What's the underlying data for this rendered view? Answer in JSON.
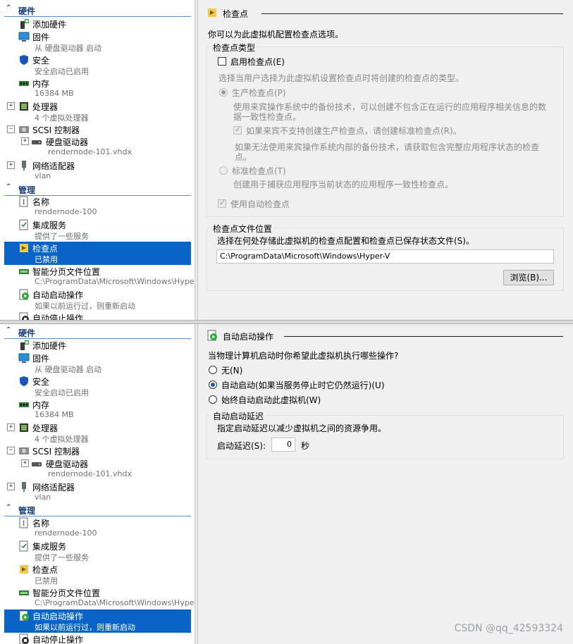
{
  "colors": {
    "selection": "#0a64c8",
    "section_header": "#1a3e7a",
    "pane_bg": "#f0f0f0"
  },
  "top_panel": {
    "tree": {
      "hardware_header": "硬件",
      "items": [
        {
          "icon": "add-hardware-icon",
          "label": "添加硬件",
          "sub": ""
        },
        {
          "icon": "firmware-icon",
          "label": "固件",
          "sub": "从 硬盘驱动器 启动"
        },
        {
          "icon": "security-shield-icon",
          "label": "安全",
          "sub": "安全启动已启用"
        },
        {
          "icon": "memory-icon",
          "label": "内存",
          "sub": "16384 MB"
        },
        {
          "icon": "processor-icon",
          "label": "处理器",
          "sub": "4 个虚拟处理器"
        },
        {
          "icon": "scsi-icon",
          "label": "SCSI 控制器",
          "sub": ""
        },
        {
          "icon": "hard-drive-icon",
          "label": "硬盘驱动器",
          "sub": "rendernode-101.vhdx"
        },
        {
          "icon": "network-adapter-icon",
          "label": "网络适配器",
          "sub": "vlan"
        }
      ],
      "management_header": "管理",
      "mgmt_items": [
        {
          "icon": "name-icon",
          "label": "名称",
          "sub": "rendernode-100"
        },
        {
          "icon": "integration-services-icon",
          "label": "集成服务",
          "sub": "提供了一些服务"
        },
        {
          "icon": "checkpoint-icon",
          "label": "检查点",
          "sub": "已禁用"
        },
        {
          "icon": "smart-paging-icon",
          "label": "智能分页文件位置",
          "sub": "C:\\ProgramData\\Microsoft\\Windows\\Hyper-V"
        },
        {
          "icon": "auto-start-icon",
          "label": "自动启动操作",
          "sub": "如果以前运行过，则重新启动"
        },
        {
          "icon": "auto-stop-icon",
          "label": "自动停止操作",
          "sub": ""
        }
      ]
    },
    "detail": {
      "title": "检查点",
      "intro": "你可以为此虚拟机配置检查点选项。",
      "type_group_title": "检查点类型",
      "enable_checkpoints": "启用检查点(E)",
      "choose_hint": "选择当用户选择为此虚拟机设置检查点时将创建的检查点的类型。",
      "production_label": "生产检查点(P)",
      "production_desc1": "使用来宾操作系统中的备份技术，可以创建不包含正在运行的应用程序相关信息的数",
      "production_desc2": "据一致性检查点。",
      "fallback_label": "如果来宾不支持创建生产检查点，请创建标准检查点(R)。",
      "fallback_desc1": "如果无法使用来宾操作系统内部的备份技术，请获取包含完整应用程序状态的检查",
      "fallback_desc2": "点。",
      "standard_label": "标准检查点(T)",
      "standard_desc": "创建用于捕获应用程序当前状态的应用程序一致性检查点。",
      "auto_label": "使用自动检查点",
      "location_group_title": "检查点文件位置",
      "location_desc": "选择在何处存储此虚拟机的检查点配置和检查点已保存状态文件(S)。",
      "location_value": "C:\\ProgramData\\Microsoft\\Windows\\Hyper-V",
      "browse_label": "浏览(B)..."
    }
  },
  "bottom_panel": {
    "tree": {
      "hardware_header": "硬件",
      "items": [
        {
          "icon": "add-hardware-icon",
          "label": "添加硬件",
          "sub": ""
        },
        {
          "icon": "firmware-icon",
          "label": "固件",
          "sub": "从 硬盘驱动器 启动"
        },
        {
          "icon": "security-shield-icon",
          "label": "安全",
          "sub": "安全启动已启用"
        },
        {
          "icon": "memory-icon",
          "label": "内存",
          "sub": "16384 MB"
        },
        {
          "icon": "processor-icon",
          "label": "处理器",
          "sub": "4 个虚拟处理器"
        },
        {
          "icon": "scsi-icon",
          "label": "SCSI 控制器",
          "sub": ""
        },
        {
          "icon": "hard-drive-icon",
          "label": "硬盘驱动器",
          "sub": "rendernode-101.vhdx"
        },
        {
          "icon": "network-adapter-icon",
          "label": "网络适配器",
          "sub": "vlan"
        }
      ],
      "management_header": "管理",
      "mgmt_items": [
        {
          "icon": "name-icon",
          "label": "名称",
          "sub": "rendernode-100"
        },
        {
          "icon": "integration-services-icon",
          "label": "集成服务",
          "sub": "提供了一些服务"
        },
        {
          "icon": "checkpoint-icon",
          "label": "检查点",
          "sub": "已禁用"
        },
        {
          "icon": "smart-paging-icon",
          "label": "智能分页文件位置",
          "sub": "C:\\ProgramData\\Microsoft\\Windows\\Hyper-V"
        },
        {
          "icon": "auto-start-icon",
          "label": "自动启动操作",
          "sub": "如果以前运行过，则重新启动"
        },
        {
          "icon": "auto-stop-icon",
          "label": "自动停止操作",
          "sub": ""
        }
      ]
    },
    "detail": {
      "title": "自动启动操作",
      "question": "当物理计算机启动时你希望此虚拟机执行哪些操作?",
      "option_none": "无(N)",
      "option_auto": "自动启动(如果当服务停止时它仍然运行)(U)",
      "option_always": "始终自动启动此虚拟机(W)",
      "delay_group_title": "自动启动延迟",
      "delay_desc": "指定启动延迟以减少虚拟机之间的资源争用。",
      "delay_label": "启动延迟(S):",
      "delay_value": "0",
      "delay_unit": "秒"
    }
  },
  "watermark": "CSDN @qq_42593324"
}
